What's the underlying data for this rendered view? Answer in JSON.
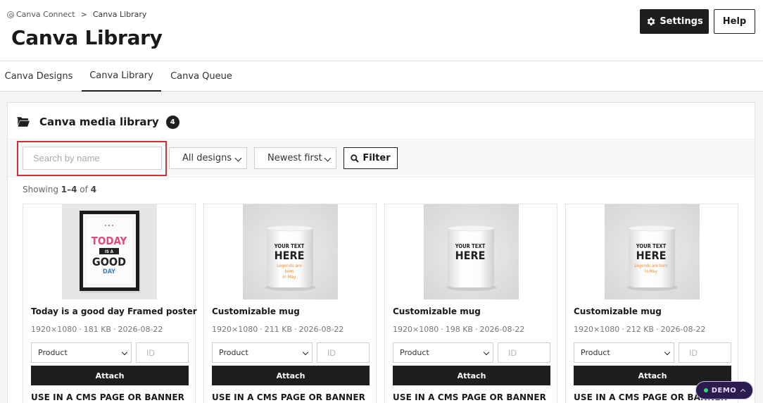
{
  "breadcrumb": {
    "root": "Canva Connect",
    "separator": ">",
    "current": "Canva Library"
  },
  "page_title": "Canva Library",
  "header_buttons": {
    "settings": "Settings",
    "help": "Help"
  },
  "tabs": [
    {
      "label": "Canva Designs",
      "active": false
    },
    {
      "label": "Canva Library",
      "active": true
    },
    {
      "label": "Canva Queue",
      "active": false
    }
  ],
  "library": {
    "title": "Canva media library",
    "count": "4",
    "search_placeholder": "Search by name",
    "design_filter": "All designs",
    "sort": "Newest first",
    "filter_button": "Filter",
    "showing_prefix": "Showing",
    "showing_range": "1–4",
    "showing_of": "of",
    "showing_total": "4"
  },
  "cards": [
    {
      "name": "Today is a good day Framed poster",
      "dimensions": "1920×1080",
      "size": "181 KB",
      "date": "2026-08-22",
      "product_select": "Product",
      "id_placeholder": "ID",
      "attach_label": "Attach",
      "cms_label": "USE IN A CMS PAGE OR BANNER",
      "image": {
        "type": "poster",
        "lines": [
          "TODAY",
          "IS A",
          "GOOD",
          "DAY"
        ],
        "colors": {
          "today": "#e04a79",
          "good": "#222222",
          "day": "#3a7fc0"
        }
      }
    },
    {
      "name": "Customizable mug",
      "dimensions": "1920×1080",
      "size": "211 KB",
      "date": "2026-08-22",
      "product_select": "Product",
      "id_placeholder": "ID",
      "attach_label": "Attach",
      "cms_label": "USE IN A CMS PAGE OR BANNER",
      "image": {
        "type": "mug",
        "lines": [
          "YOUR TEXT",
          "HERE"
        ],
        "sub_lines": [
          "Legends are",
          "born",
          "in May"
        ],
        "accent": "#f28a2e"
      }
    },
    {
      "name": "Customizable mug",
      "dimensions": "1920×1080",
      "size": "198 KB",
      "date": "2026-08-22",
      "product_select": "Product",
      "id_placeholder": "ID",
      "attach_label": "Attach",
      "cms_label": "USE IN A CMS PAGE OR BANNER",
      "image": {
        "type": "mug",
        "lines": [
          "YOUR TEXT",
          "HERE"
        ],
        "sub_lines": []
      }
    },
    {
      "name": "Customizable mug",
      "dimensions": "1920×1080",
      "size": "212 KB",
      "date": "2026-08-22",
      "product_select": "Product",
      "id_placeholder": "ID",
      "attach_label": "Attach",
      "cms_label": "USE IN A CMS PAGE OR BANNER",
      "image": {
        "type": "mug",
        "lines": [
          "YOUR TEXT",
          "HERE"
        ],
        "sub_lines": [
          "Legends are born",
          "in May"
        ],
        "accent": "#f28a2e"
      }
    }
  ],
  "demo_badge": "DEMO",
  "colors": {
    "primary_dark": "#1e1e1e",
    "highlight": "#d32f2f",
    "demo_bg": "#2c1b4f"
  }
}
